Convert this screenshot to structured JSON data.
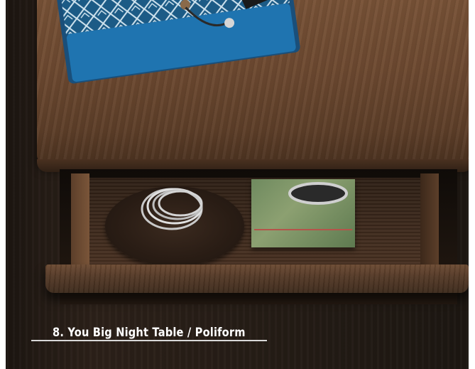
{
  "caption": {
    "text": "8. You Big Night Table / Poliform"
  },
  "colors": {
    "wood_top": "#6e4a31",
    "wood_dark": "#2c2119",
    "bag_blue": "#1f6fa8",
    "box_green": "#8ca071",
    "caption_text": "#ffffff"
  },
  "icons": [
    "night-table-photo"
  ]
}
